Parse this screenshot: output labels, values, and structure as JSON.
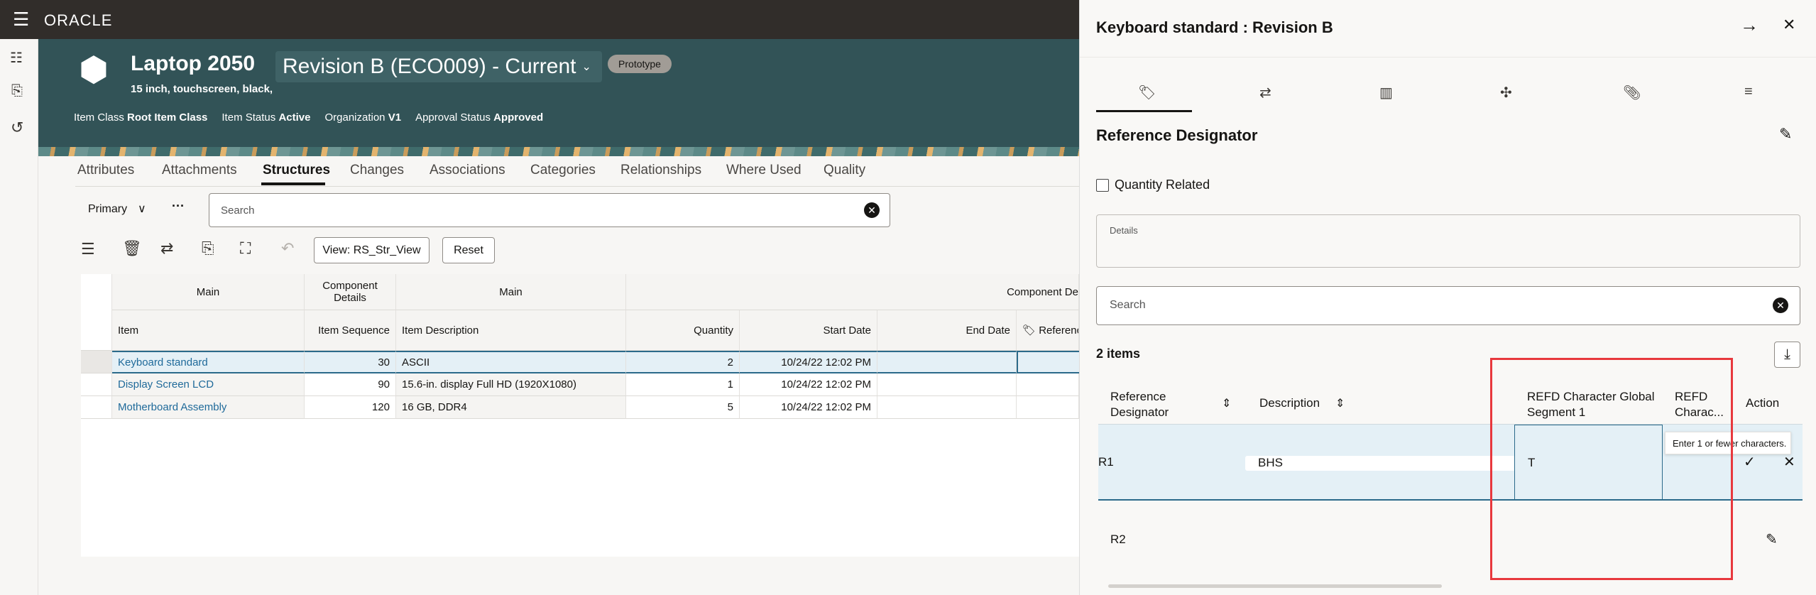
{
  "topbar": {
    "brand": "ORACLE"
  },
  "header": {
    "title": "Laptop 2050",
    "revision": "Revision B (ECO009) - Current",
    "badge": "Prototype",
    "subtitle": "15 inch, touchscreen, black,",
    "attrs": [
      {
        "label": "Item Class",
        "value": "Root Item Class"
      },
      {
        "label": "Item Status",
        "value": "Active"
      },
      {
        "label": "Organization",
        "value": "V1"
      },
      {
        "label": "Approval Status",
        "value": "Approved"
      }
    ]
  },
  "tabs": [
    "Attributes",
    "Attachments",
    "Structures",
    "Changes",
    "Associations",
    "Categories",
    "Relationships",
    "Where Used",
    "Quality"
  ],
  "toolbar": {
    "structure": "Primary",
    "search_placeholder": "Search",
    "view": "View: RS_Str_View",
    "reset": "Reset"
  },
  "grid": {
    "groups": [
      "Main",
      "Component Details",
      "Main",
      "Component De"
    ],
    "columns": [
      "Item",
      "Item Sequence",
      "Item Description",
      "Quantity",
      "Start Date",
      "End Date",
      "Referenc"
    ],
    "rows": [
      [
        "Keyboard standard",
        "30",
        "ASCII",
        "2",
        "10/24/22 12:02 PM",
        ""
      ],
      [
        "Display Screen LCD",
        "90",
        "15.6-in. display Full HD (1920X1080)",
        "1",
        "10/24/22 12:02 PM",
        ""
      ],
      [
        "Motherboard Assembly",
        "120",
        "16 GB, DDR4",
        "5",
        "10/24/22 12:02 PM",
        ""
      ]
    ]
  },
  "panel": {
    "title": "Keyboard standard : Revision B",
    "section": "Reference Designator",
    "checkbox": "Quantity Related",
    "details_label": "Details",
    "search_placeholder": "Search",
    "count": "2 items",
    "columns": [
      "Reference Designator",
      "Description",
      "REFD Character Global Segment 1",
      "REFD Charac...",
      "Action"
    ],
    "rows": [
      {
        "refdes": "R1",
        "description": "BHS",
        "segment1": "T"
      },
      {
        "refdes": "R2",
        "description": "",
        "segment1": ""
      }
    ],
    "tooltip": "Enter 1 or fewer characters."
  },
  "colors": {
    "header": "#325357",
    "topbar": "#312d2a",
    "highlight": "#e4f0f6",
    "annotation": "#e8383d"
  }
}
